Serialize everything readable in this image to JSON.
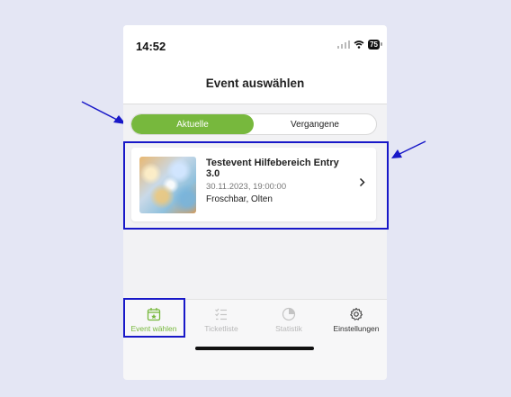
{
  "status": {
    "time": "14:52",
    "battery": "75"
  },
  "header": {
    "title": "Event auswählen"
  },
  "segmented": {
    "active": "Aktuelle",
    "inactive": "Vergangene"
  },
  "event": {
    "title": "Testevent Hilfebereich Entry 3.0",
    "datetime": "30.11.2023, 19:00:00",
    "location": "Froschbar, Olten"
  },
  "tabbar": {
    "tabs": [
      {
        "label": "Event wählen",
        "icon": "calendar-star-icon"
      },
      {
        "label": "Ticketliste",
        "icon": "checklist-icon"
      },
      {
        "label": "Statistik",
        "icon": "pie-chart-icon"
      },
      {
        "label": "Einstellungen",
        "icon": "gear-icon"
      }
    ]
  },
  "colors": {
    "accent": "#77b83d",
    "highlight": "#1818c8",
    "background": "#e4e6f4"
  }
}
